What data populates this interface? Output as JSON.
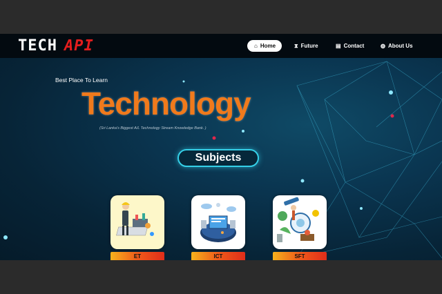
{
  "logo": {
    "part1": "TECH",
    "part2": "API"
  },
  "nav": {
    "items": [
      {
        "label": "Home",
        "icon": "home-icon",
        "active": true
      },
      {
        "label": "Future",
        "icon": "hourglass-icon",
        "active": false
      },
      {
        "label": "Contact",
        "icon": "id-card-icon",
        "active": false
      },
      {
        "label": "About Us",
        "icon": "globe-icon",
        "active": false
      }
    ]
  },
  "hero": {
    "kicker": "Best Place To Learn",
    "title": "Technology",
    "subtitle": "(Sri Lanka's Biggest A/L Technology Stream Knowledge Bank. )"
  },
  "subjects_button": "Subjects",
  "cards": [
    {
      "label": "ET",
      "icon": "engineering-illustration"
    },
    {
      "label": "ICT",
      "icon": "ict-illustration"
    },
    {
      "label": "SFT",
      "icon": "science-illustration"
    }
  ],
  "colors": {
    "accent": "#f07a1c",
    "logo_red": "#e31d1d",
    "button_glow": "#35d0e8",
    "background": "#072437"
  }
}
